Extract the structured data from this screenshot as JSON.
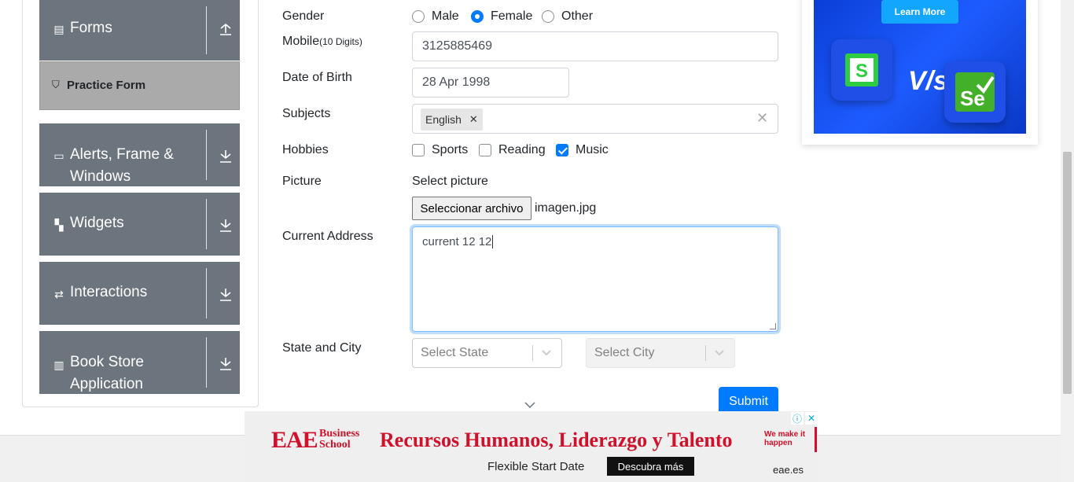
{
  "sidebar": {
    "groups": [
      {
        "label": "Forms",
        "icon": "form-icon"
      },
      {
        "label": "Alerts, Frame & Windows",
        "icon": "window-icon"
      },
      {
        "label": "Widgets",
        "icon": "widgets-icon"
      },
      {
        "label": "Interactions",
        "icon": "interactions-icon"
      },
      {
        "label": "Book Store Application",
        "icon": "books-icon"
      }
    ],
    "active_item": "Practice Form"
  },
  "form": {
    "gender_label": "Gender",
    "gender_options": [
      "Male",
      "Female",
      "Other"
    ],
    "gender_selected": "Female",
    "mobile_label": "Mobile",
    "mobile_hint": "(10 Digits)",
    "mobile_value": "3125885469",
    "dob_label": "Date of Birth",
    "dob_value": "28 Apr 1998",
    "subjects_label": "Subjects",
    "subjects_chips": [
      "English"
    ],
    "hobbies_label": "Hobbies",
    "hobbies": [
      {
        "label": "Sports",
        "checked": false
      },
      {
        "label": "Reading",
        "checked": false
      },
      {
        "label": "Music",
        "checked": true
      }
    ],
    "picture_label": "Picture",
    "picture_hint": "Select picture",
    "file_button": "Seleccionar archivo",
    "file_name": "imagen.jpg",
    "address_label": "Current Address",
    "address_value": "current 12 12",
    "state_city_label": "State and City",
    "state_placeholder": "Select State",
    "city_placeholder": "Select City",
    "submit_label": "Submit"
  },
  "side_ad": {
    "learn_more": "Learn More",
    "vs_text": "V/s"
  },
  "banner_ad": {
    "brand": "EAE",
    "brand_sub": "Business School",
    "headline": "Recursos Humanos, Liderazgo y Talento",
    "motto": "We make it happen",
    "subline": "Flexible Start Date",
    "cta": "Descubra más",
    "domain": "eae.es"
  },
  "colors": {
    "primary": "#007bff",
    "sidebar_group": "#6c757d",
    "ad_red": "#d0112b"
  }
}
